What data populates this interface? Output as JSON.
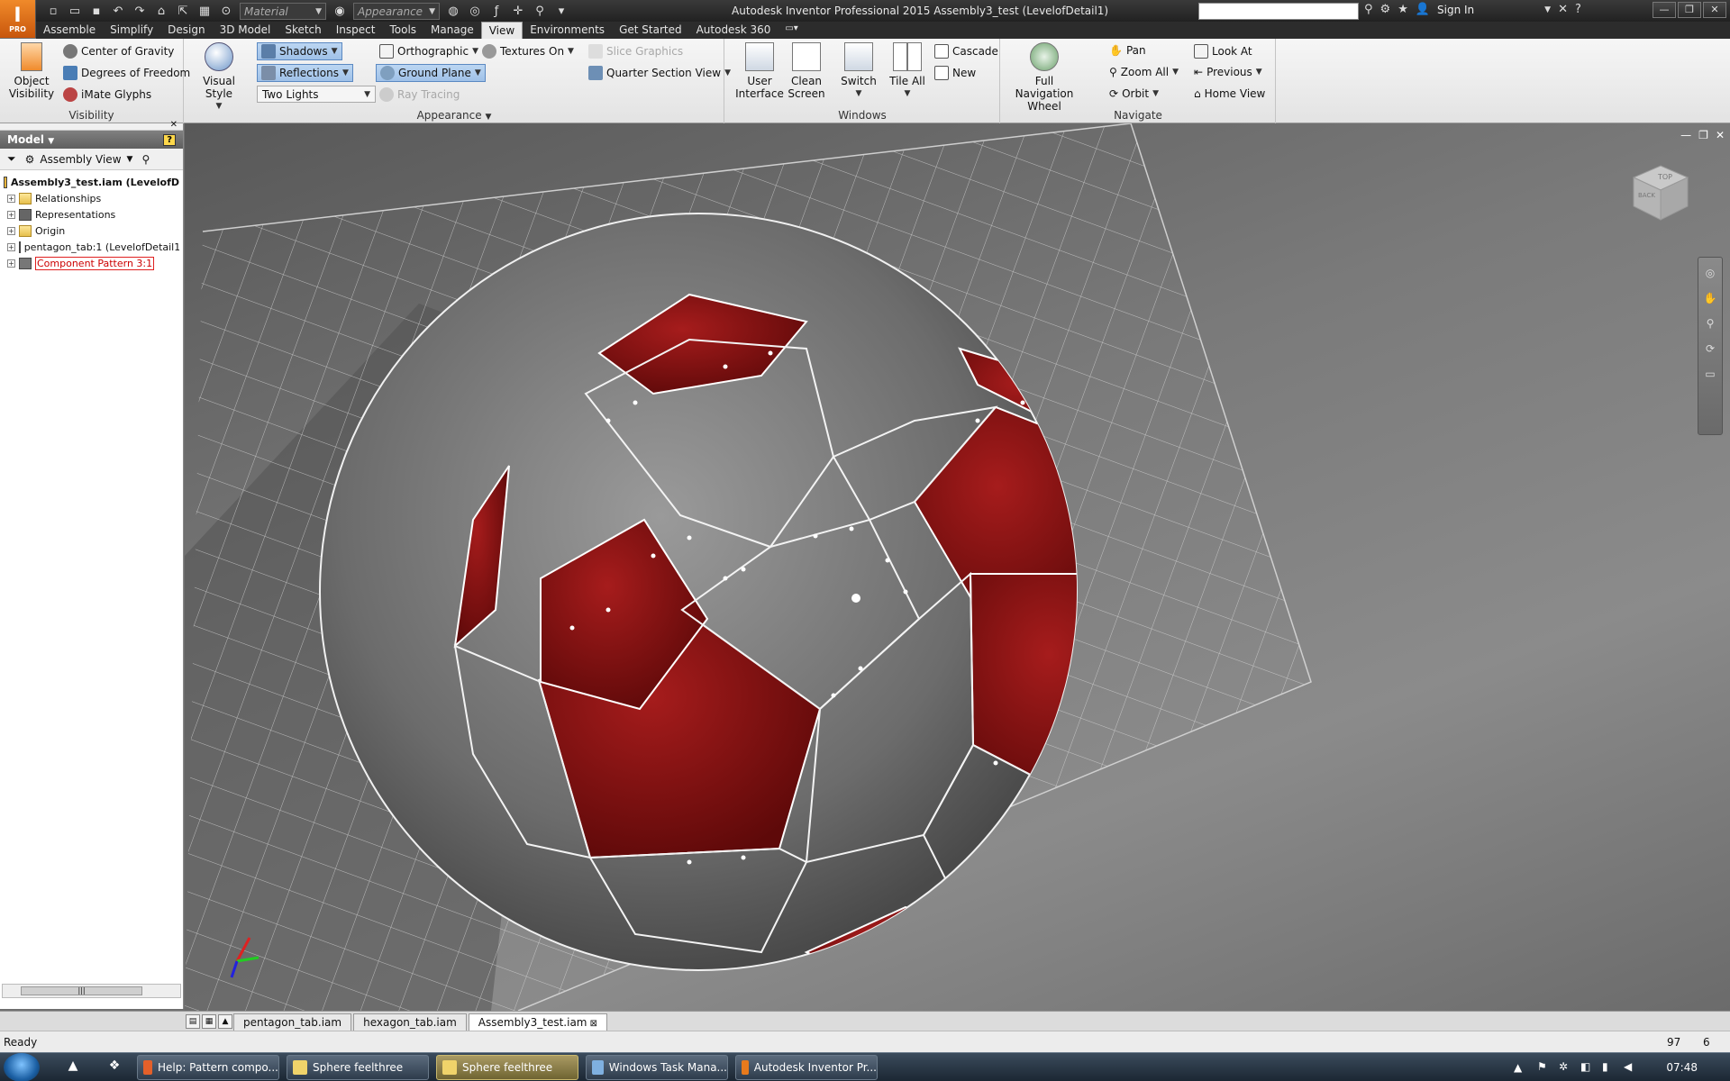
{
  "app": {
    "logo_text": "I",
    "logo_sub": "PRO",
    "window_title": "Autodesk Inventor Professional 2015    Assembly3_test (LevelofDetail1)",
    "qat": {
      "material": "Material",
      "appearance": "Appearance"
    },
    "sign_in": "Sign In"
  },
  "menu": [
    "Assemble",
    "Simplify",
    "Design",
    "3D Model",
    "Sketch",
    "Inspect",
    "Tools",
    "Manage",
    "View",
    "Environments",
    "Get Started",
    "Autodesk 360"
  ],
  "menu_active": "View",
  "ribbon": {
    "visibility": {
      "title": "Visibility",
      "object_visibility": "Object Visibility",
      "center_of_gravity": "Center of Gravity",
      "degrees_of_freedom": "Degrees of Freedom",
      "imate_glyphs": "iMate Glyphs"
    },
    "appearance": {
      "title": "Appearance",
      "visual_style": "Visual Style",
      "shadows": "Shadows",
      "reflections": "Reflections",
      "lighting": "Two Lights",
      "orthographic": "Orthographic",
      "ground_plane": "Ground Plane",
      "ray_tracing": "Ray Tracing",
      "textures_on": "Textures On",
      "slice_graphics": "Slice Graphics",
      "quarter_section_view": "Quarter Section View"
    },
    "windows": {
      "title": "Windows",
      "user_interface": "User Interface",
      "clean_screen": "Clean Screen",
      "switch": "Switch",
      "tile_all": "Tile All",
      "cascade": "Cascade",
      "new": "New"
    },
    "navigate": {
      "title": "Navigate",
      "full_navigation_wheel": "Full Navigation Wheel",
      "pan": "Pan",
      "zoom_all": "Zoom All",
      "orbit": "Orbit",
      "look_at": "Look At",
      "previous": "Previous",
      "home_view": "Home View"
    }
  },
  "browser": {
    "title": "Model",
    "view_mode": "Assembly View",
    "tree": [
      {
        "label": "Assembly3_test.iam (LevelofD",
        "kind": "root"
      },
      {
        "label": "Relationships",
        "kind": "folder"
      },
      {
        "label": "Representations",
        "kind": "rep"
      },
      {
        "label": "Origin",
        "kind": "folder"
      },
      {
        "label": "pentagon_tab:1 (LevelofDetail1",
        "kind": "part"
      },
      {
        "label": "Component Pattern 3:1",
        "kind": "pattern",
        "selected": true
      }
    ]
  },
  "doc_tabs": [
    "pentagon_tab.iam",
    "hexagon_tab.iam",
    "Assembly3_test.iam"
  ],
  "doc_tab_active": "Assembly3_test.iam",
  "viewcube": {
    "top_label": "TOP",
    "front_label": "BACK"
  },
  "status": {
    "text": "Ready",
    "n1": "97",
    "n2": "6"
  },
  "taskbar": {
    "tasks": [
      {
        "label": "Help: Pattern compo...",
        "icon_color": "#e4602a",
        "active": false
      },
      {
        "label": "Sphere feelthree",
        "icon_color": "#f0d36a",
        "active": false
      },
      {
        "label": "Sphere feelthree",
        "icon_color": "#f0d36a",
        "active": true
      },
      {
        "label": "Windows Task Mana...",
        "icon_color": "#7fb0e0",
        "active": false
      },
      {
        "label": "Autodesk Inventor Pr...",
        "icon_color": "#e87a1c",
        "active": false
      }
    ],
    "clock": "07:48"
  },
  "colors": {
    "panel_red": "#8a1212",
    "panel_grey": "#7a7a7a",
    "accent": "#3a6fb5"
  }
}
